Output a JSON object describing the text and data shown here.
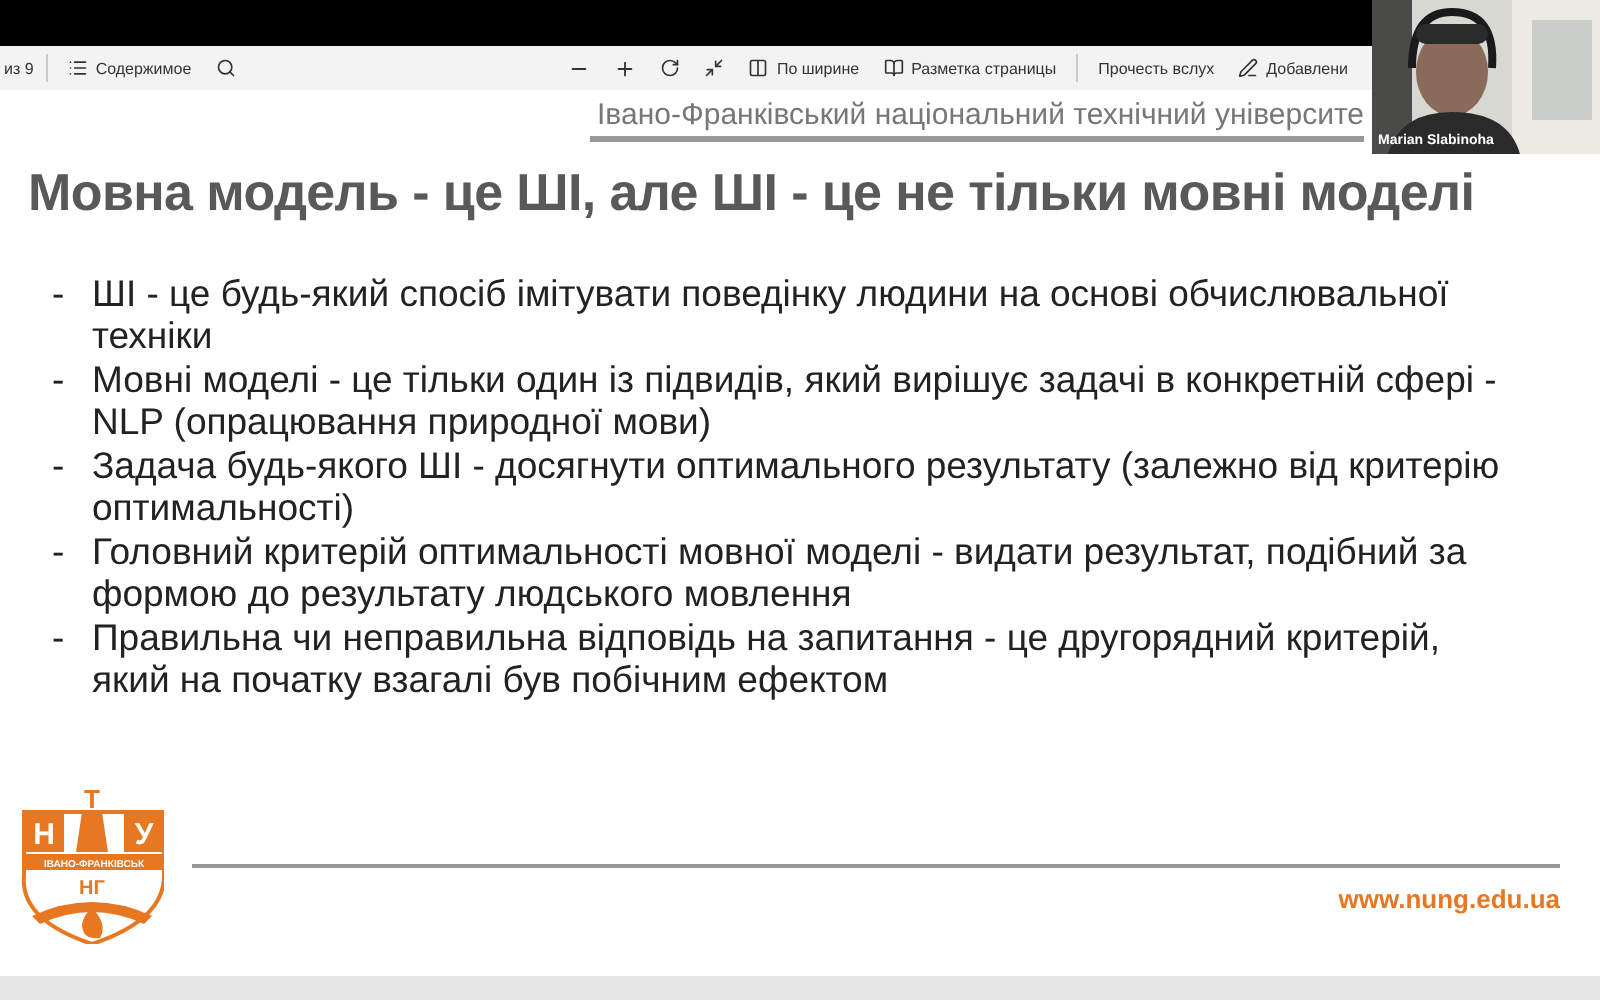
{
  "toolbar": {
    "page_count": "из 9",
    "contents": "Содержимое",
    "fit_width": "По ширине",
    "page_layout": "Разметка страницы",
    "read_aloud": "Прочесть вслух",
    "annotate": "Добавлени"
  },
  "slide": {
    "header": "Івано-Франківський національний технічний університе",
    "title": "Мовна модель - це ШІ, але ШІ - це не тільки мовні моделі",
    "bullets": [
      {
        "marker": "-",
        "text": "ШІ - це будь-який спосіб імітувати поведінку людини на основі обчислювальної техніки"
      },
      {
        "marker": "-",
        "text": "Мовні моделі - це тільки один із підвидів, який вирішує задачі в конкретній сфері - NLP (опрацювання природної мови)"
      },
      {
        "marker": "-",
        "text": "Задача будь-якого ШІ - досягнути оптимального результату (залежно від критерію оптимальності)"
      },
      {
        "marker": "-",
        "text": "Головний критерій оптимальності мовної моделі - видати результат, подібний за формою до результату людського мовлення"
      },
      {
        "marker": "-",
        "text": "Правильна чи неправильна відповідь на запитання - це другорядний критерій, який на початку взагалі був побічним ефектом"
      }
    ],
    "logo": {
      "left": "Н",
      "top": "Т",
      "right": "У",
      "ribbon": "ІВАНО-ФРАНКІВСЬК",
      "lower": "НГ"
    },
    "website": "www.nung.edu.ua"
  },
  "video": {
    "name": "Marian Slabinoha"
  }
}
